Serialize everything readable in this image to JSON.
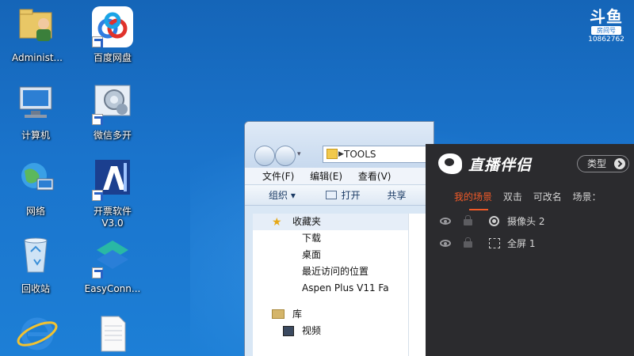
{
  "desktop": {
    "icons": [
      {
        "label": "Administ...",
        "icon": "user-folder-icon"
      },
      {
        "label": "百度网盘",
        "icon": "baidu-netdisk-icon"
      },
      {
        "label": "计算机",
        "icon": "computer-icon"
      },
      {
        "label": "微信多开",
        "icon": "wechat-multi-icon"
      },
      {
        "label": "网络",
        "icon": "network-icon"
      },
      {
        "label": "开票软件\nV3.0",
        "icon": "invoice-software-icon"
      },
      {
        "label": "回收站",
        "icon": "recycle-bin-icon"
      },
      {
        "label": "EasyConn...",
        "icon": "easyconnect-icon"
      },
      {
        "label": "",
        "icon": "ie-icon"
      },
      {
        "label": "",
        "icon": "text-file-icon"
      }
    ]
  },
  "douyu": {
    "logo": "斗鱼",
    "room_label": "房间号",
    "room_number": "10862762"
  },
  "explorer": {
    "address": "TOOLS",
    "menu": [
      "文件(F)",
      "编辑(E)",
      "查看(V)"
    ],
    "toolbar": {
      "organize": "组织 ▾",
      "open": "打开",
      "share": "共享"
    },
    "nav": {
      "favorites": "收藏夹",
      "downloads": "下载",
      "desktop": "桌面",
      "recent": "最近访问的位置",
      "aspen": "Aspen Plus V11 Fa",
      "library": "库",
      "videos": "视频"
    }
  },
  "live": {
    "title": "直播伴侣",
    "type_button": "类型",
    "tabs": [
      "我的场景",
      "双击",
      "可改名",
      "场景："
    ],
    "sources": [
      {
        "label": "摄像头 2",
        "icon": "camera-icon"
      },
      {
        "label": "全屏 1",
        "icon": "fullscreen-icon"
      }
    ],
    "accent": "#f05a28"
  }
}
